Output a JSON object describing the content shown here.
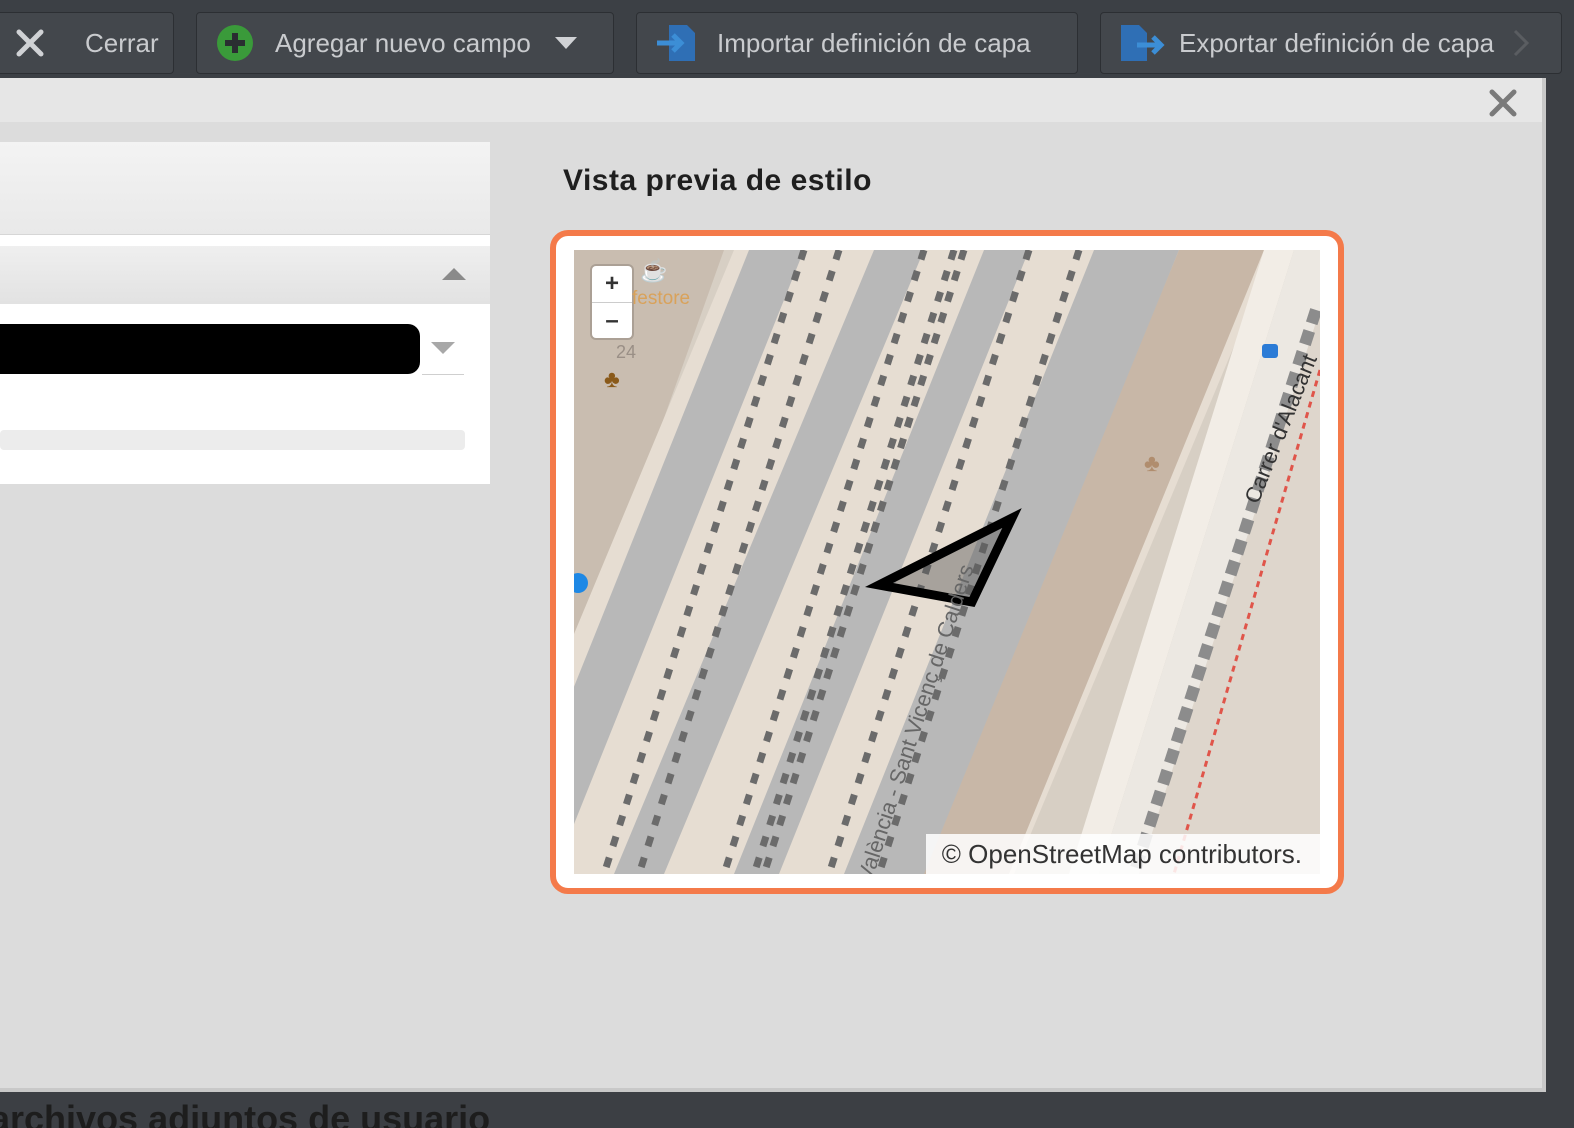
{
  "toolbar": {
    "close_label": "Cerrar",
    "add_field_label": "Agregar nuevo campo",
    "import_label": "Importar definición de capa",
    "export_label": "Exportar definición de capa"
  },
  "dialog": {
    "preview_title": "Vista previa de estilo"
  },
  "map": {
    "zoom_in": "+",
    "zoom_out": "–",
    "attribution": "© OpenStreetMap contributors.",
    "poi_cafe": "festore",
    "house_number": "24",
    "street_right": "Carrer d'Alacant",
    "street_center": "València - Sant Vicenç de Calders"
  },
  "footer": {
    "partial_heading": "archivos adjuntos de usuario"
  },
  "colors": {
    "accent_border": "#f47a4a",
    "add_icon": "#3a9a3a",
    "doc_icon": "#2f6fb5",
    "map_background": "#d7cfc4",
    "rail_gray": "#b8b8b8"
  },
  "icons": {
    "close": "close-x-icon",
    "add": "plus-circle-icon",
    "dropdown": "chevron-down-icon",
    "import": "import-file-icon",
    "export": "export-file-icon",
    "more": "chevron-right-icon"
  }
}
